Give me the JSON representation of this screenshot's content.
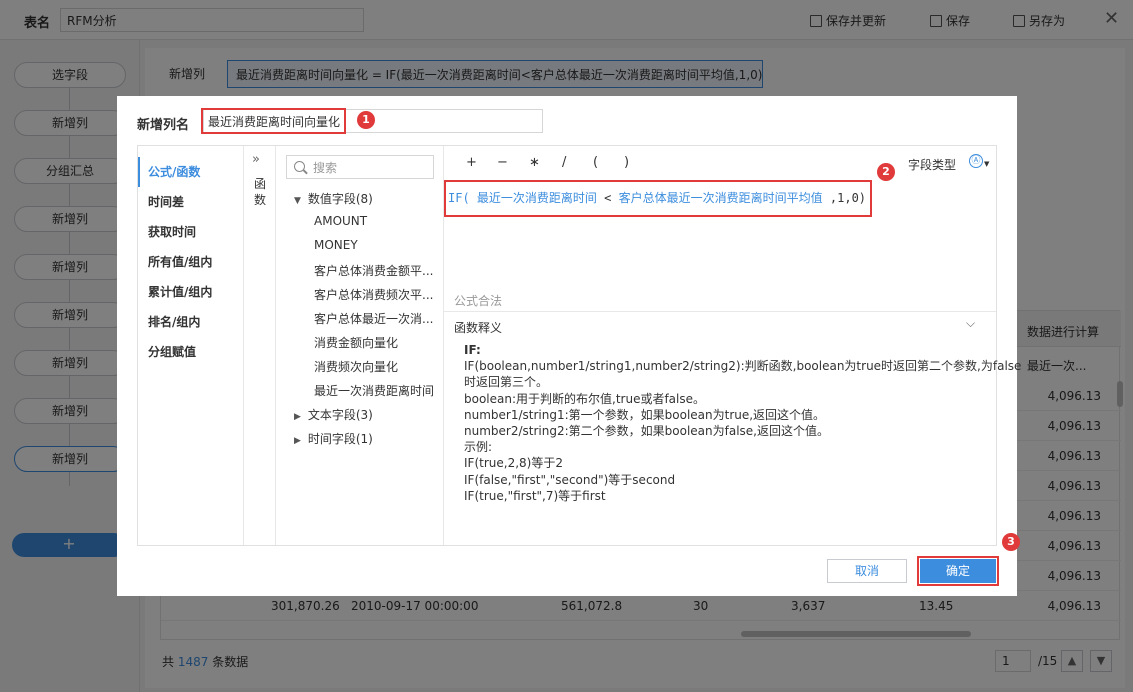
{
  "topbar": {
    "table_label": "表名",
    "table_name": "RFM分析",
    "save_update": "保存并更新",
    "save": "保存",
    "save_as": "另存为"
  },
  "steps": [
    "选字段",
    "新增列",
    "分组汇总",
    "新增列",
    "新增列",
    "新增列",
    "新增列",
    "新增列",
    "新增列"
  ],
  "add_step": "+",
  "main": {
    "new_col_label": "新增列",
    "formula": "最近消费距离时间向量化 = IF(最近一次消费距离时间<客户总体最近一次消费距离时间平均值,1,0)"
  },
  "grid": {
    "header_right": "数据进行计算",
    "col_header": "最近一次...",
    "last_col_values": [
      "4,096.13",
      "4,096.13",
      "4,096.13",
      "4,096.13",
      "4,096.13",
      "4,096.13",
      "4,096.13",
      "4,096.13"
    ],
    "last_row": [
      "301,870.26",
      "2010-09-17 00:00:00",
      "561,072.8",
      "30",
      "3,637",
      "13.45",
      "4,096.13"
    ]
  },
  "footer": {
    "prefix": "共",
    "count": "1487",
    "suffix": "条数据",
    "page": "1",
    "total": "/15"
  },
  "dialog": {
    "name_label": "新增列名",
    "name_value": "最近消费距离时间向量化",
    "markers": [
      "1",
      "2",
      "3"
    ],
    "categories": [
      "公式/函数",
      "时间差",
      "获取时间",
      "所有值/组内",
      "累计值/组内",
      "排名/组内",
      "分组赋值"
    ],
    "func_tab": "函数",
    "search_placeholder": "搜索",
    "numeric_group": "数值字段(8)",
    "numeric_fields": [
      "AMOUNT",
      "MONEY",
      "客户总体消费金额平...",
      "客户总体消费频次平...",
      "客户总体最近一次消...",
      "消费金额向量化",
      "消费频次向量化",
      "最近一次消费距离时间"
    ],
    "text_group": "文本字段(3)",
    "time_group": "时间字段(1)",
    "operators": [
      "+",
      "−",
      "∗",
      "/",
      "(",
      ")"
    ],
    "field_type_label": "字段类型",
    "field_type_icon": "Ⓐ",
    "code_fn": "IF(",
    "code_field1": "最近一次消费距离时间",
    "code_lt": "<",
    "code_field2": "客户总体最近一次消费距离时间平均值",
    "code_tail": ",1,0)",
    "status": "公式合法",
    "explain_title": "函数释义",
    "explain_lines": [
      "IF:",
      "IF(boolean,number1/string1,number2/string2):判断函数,boolean为true时返回第二个参数,为false",
      "时返回第三个。",
      "boolean:用于判断的布尔值,true或者false。",
      "number1/string1:第一个参数，如果boolean为true,返回这个值。",
      "number2/string2:第二个参数，如果boolean为false,返回这个值。",
      "示例:",
      "IF(true,2,8)等于2",
      "IF(false,\"first\",\"second\")等于second",
      "IF(true,\"first\",7)等于first"
    ],
    "cancel": "取消",
    "ok": "确定"
  }
}
